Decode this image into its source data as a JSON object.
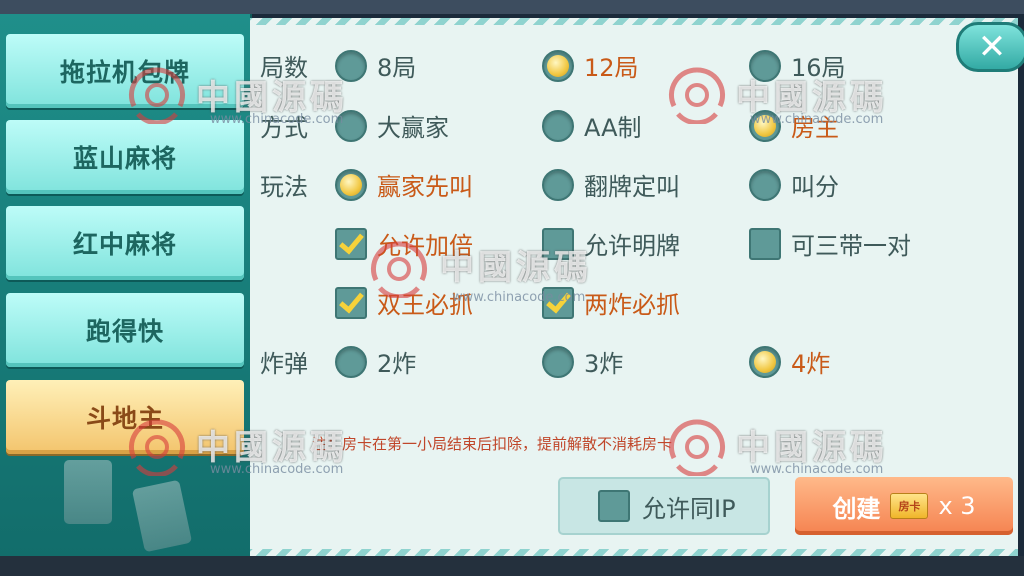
{
  "sidebar": {
    "games": [
      {
        "label": "拖拉机包牌",
        "active": false
      },
      {
        "label": "蓝山麻将",
        "active": false
      },
      {
        "label": "红中麻将",
        "active": false
      },
      {
        "label": "跑得快",
        "active": false
      },
      {
        "label": "斗地主",
        "active": true
      }
    ]
  },
  "settings": {
    "rounds": {
      "label": "局数",
      "options": [
        {
          "label": "8局",
          "selected": false
        },
        {
          "label": "12局",
          "selected": true
        },
        {
          "label": "16局",
          "selected": false
        }
      ]
    },
    "mode": {
      "label": "方式",
      "options": [
        {
          "label": "大赢家",
          "selected": false
        },
        {
          "label": "AA制",
          "selected": false
        },
        {
          "label": "房主",
          "selected": true
        }
      ]
    },
    "play": {
      "label": "玩法",
      "options": [
        {
          "label": "赢家先叫",
          "selected": true
        },
        {
          "label": "翻牌定叫",
          "selected": false
        },
        {
          "label": "叫分",
          "selected": false
        }
      ],
      "checkboxes": [
        {
          "label": "允许加倍",
          "checked": true
        },
        {
          "label": "允许明牌",
          "checked": false
        },
        {
          "label": "可三带一对",
          "checked": false
        },
        {
          "label": "双王必抓",
          "checked": true
        },
        {
          "label": "两炸必抓",
          "checked": true
        }
      ]
    },
    "bomb": {
      "label": "炸弹",
      "options": [
        {
          "label": "2炸",
          "selected": false
        },
        {
          "label": "3炸",
          "selected": false
        },
        {
          "label": "4炸",
          "selected": true
        }
      ]
    },
    "note": "注：房卡在第一小局结束后扣除，提前解散不消耗房卡"
  },
  "footer": {
    "same_ip_label": "允许同IP",
    "same_ip_checked": false,
    "create_label": "创建",
    "card_icon_text": "房卡",
    "cost": "x 3"
  },
  "close_label": "✕",
  "watermark": {
    "text": "中國源碼",
    "url": "www.chinacode.com"
  },
  "colors": {
    "selected_text": "#c95a18",
    "normal_text": "#3f5a5a",
    "active_tab": "#f3c46c",
    "tab": "#7fe3dc",
    "create_button": "#f58250"
  }
}
